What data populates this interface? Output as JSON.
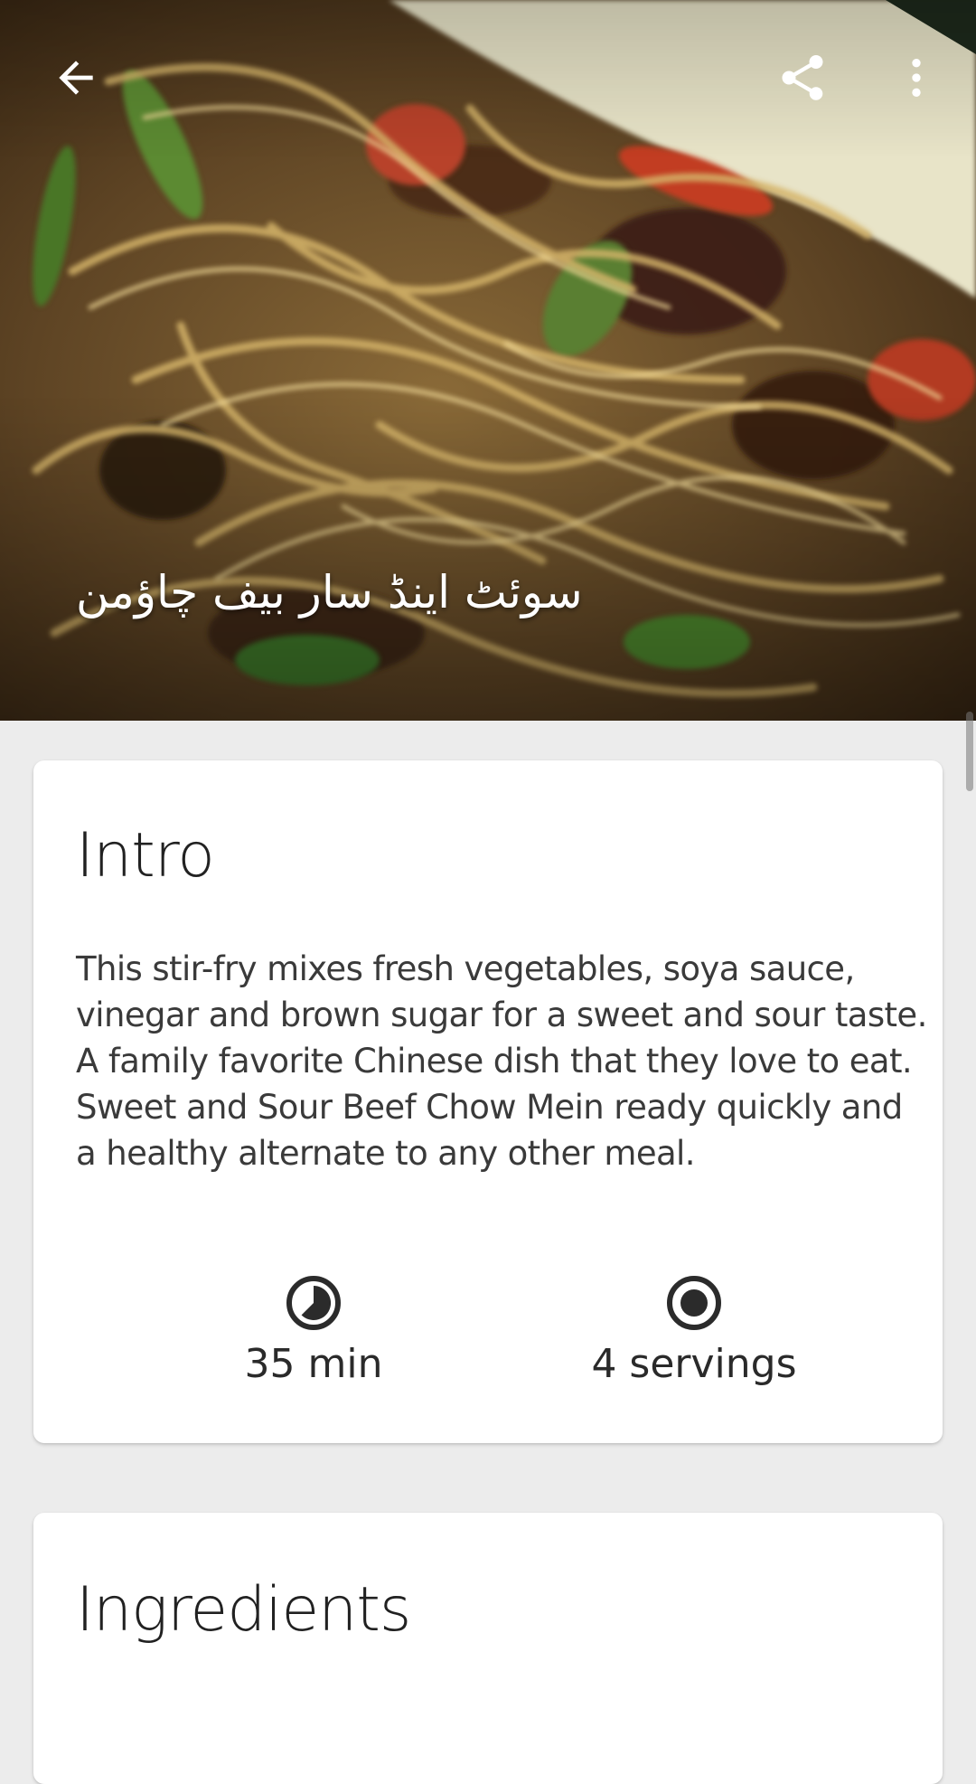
{
  "hero": {
    "title": "سوئٹ اینڈ سار بیف چاؤمن",
    "image": "noodle-dish-photo"
  },
  "toolbar": {
    "back_icon": "arrow-left-icon",
    "share_icon": "share-icon",
    "more_icon": "more-vertical-icon"
  },
  "intro": {
    "heading": "Intro",
    "text": "This stir-fry mixes fresh vegetables, soya sauce, vinegar and brown sugar for a sweet and sour taste. A family favorite Chinese dish that they love to eat. Sweet and Sour Beef Chow Mein ready quickly and a healthy alternate to any other meal.",
    "time_label": "35 min",
    "servings_label": "4 servings",
    "time_icon": "timer-icon",
    "servings_icon": "servings-icon"
  },
  "ingredients": {
    "heading": "Ingredients"
  },
  "colors": {
    "background": "#ececec",
    "card": "#ffffff",
    "text_primary": "#212121",
    "icon_dark": "#2b2b2b"
  }
}
